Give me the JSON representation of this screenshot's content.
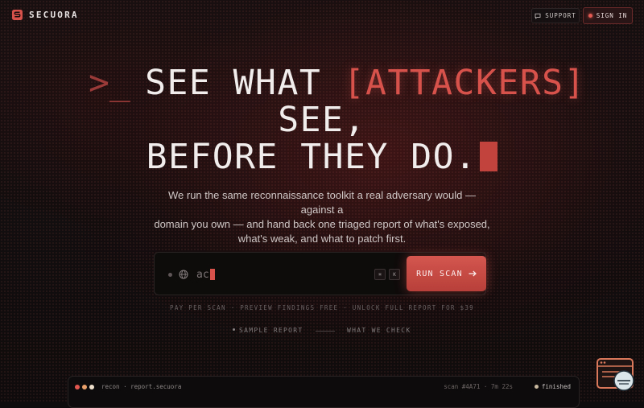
{
  "brand": {
    "name": "SECUORA"
  },
  "header": {
    "support_label": "SUPPORT",
    "signin_label": "SIGN IN"
  },
  "hero": {
    "prompt": ">_",
    "line1_prefix": "SEE WHAT ",
    "line1_accent": "[ATTACKERS]",
    "line2": "SEE,",
    "line3": "BEFORE THEY DO.",
    "subtitle_line1": "We run the same reconnaissance toolkit a real adversary would — against a",
    "subtitle_line2": "domain you own — and hand back one triaged report of what's exposed,",
    "subtitle_line3": "what's weak, and what to patch first."
  },
  "search": {
    "value": "ac",
    "kbd1": "⌘",
    "kbd2": "K",
    "run_label": "RUN SCAN"
  },
  "pricing_note": "PAY PER SCAN · PREVIEW FINDINGS FREE · UNLOCK FULL REPORT FOR $39",
  "links": {
    "sample_report": "SAMPLE REPORT",
    "what_we_check": "WHAT WE CHECK"
  },
  "terminal": {
    "path": "recon · report.secuora",
    "meta": "scan #4A71 · 7m 22s",
    "status": "finished"
  },
  "colors": {
    "accent": "#d8524c",
    "background": "#0f0c0d"
  },
  "icons": {
    "logo": "secuora-logo-icon",
    "support": "chat-icon",
    "search": "globe-icon",
    "run": "arrow-right-icon",
    "widget": "window-chat-widget-icon"
  }
}
